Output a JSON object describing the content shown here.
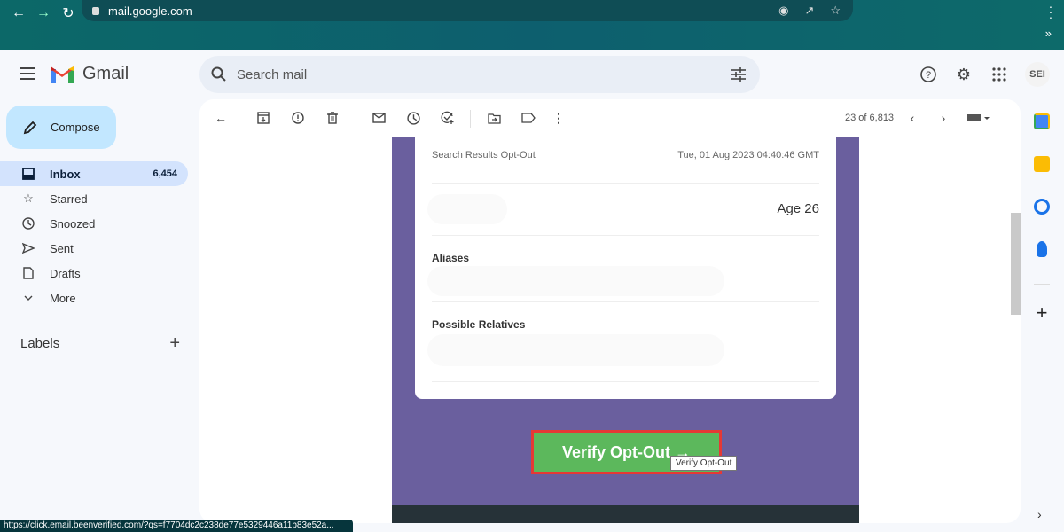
{
  "browser": {
    "url": "mail.google.com",
    "icons": [
      "eye-icon",
      "share-icon",
      "star-icon"
    ],
    "overflow": "»"
  },
  "header": {
    "app_name": "Gmail",
    "search_placeholder": "Search mail",
    "avatar_text": "SEI"
  },
  "compose": {
    "label": "Compose"
  },
  "sidebar": {
    "items": [
      {
        "label": "Inbox",
        "count": "6,454",
        "icon": "inbox-icon"
      },
      {
        "label": "Starred",
        "icon": "star-icon"
      },
      {
        "label": "Snoozed",
        "icon": "clock-icon"
      },
      {
        "label": "Sent",
        "icon": "send-icon"
      },
      {
        "label": "Drafts",
        "icon": "draft-icon"
      },
      {
        "label": "More",
        "icon": "chevron-down-icon"
      }
    ],
    "labels_title": "Labels"
  },
  "toolbar": {
    "pager": "23 of 6,813"
  },
  "email": {
    "subject_small": "Search Results Opt-Out",
    "date": "Tue, 01 Aug 2023 04:40:46 GMT",
    "age": "Age 26",
    "aliases_label": "Aliases",
    "relatives_label": "Possible Relatives",
    "button_label": "Verify Opt-Out →",
    "tooltip": "Verify Opt-Out",
    "colors": {
      "background": "#6a5f9e",
      "button": "#5cb85c",
      "highlight": "#e53935"
    }
  },
  "status_url": "https://click.email.beenverified.com/?qs=f7704dc2c238de77e5329446a11b83e52a..."
}
